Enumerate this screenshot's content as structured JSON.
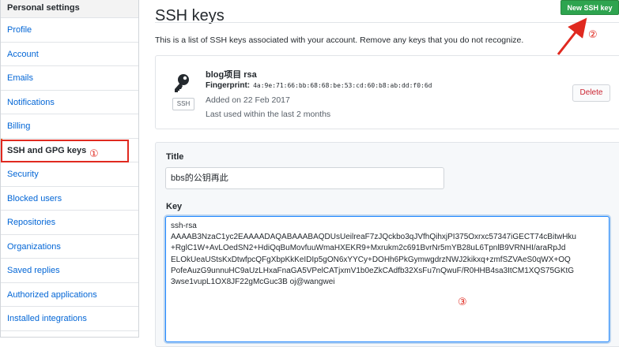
{
  "sidebar": {
    "header": "Personal settings",
    "items": [
      {
        "label": "Profile"
      },
      {
        "label": "Account"
      },
      {
        "label": "Emails"
      },
      {
        "label": "Notifications"
      },
      {
        "label": "Billing"
      },
      {
        "label": "SSH and GPG keys",
        "selected": true
      },
      {
        "label": "Security"
      },
      {
        "label": "Blocked users"
      },
      {
        "label": "Repositories"
      },
      {
        "label": "Organizations"
      },
      {
        "label": "Saved replies"
      },
      {
        "label": "Authorized applications"
      },
      {
        "label": "Installed integrations"
      }
    ]
  },
  "header": {
    "title": "SSH keys",
    "new_key_button": "New SSH key"
  },
  "intro": "This is a list of SSH keys associated with your account. Remove any keys that you do not recognize.",
  "key": {
    "name": "blog项目 rsa",
    "fingerprint_label": "Fingerprint:",
    "fingerprint": "4a:9e:71:66:bb:68:68:be:53:cd:60:b8:ab:dd:f0:6d",
    "badge": "SSH",
    "added": "Added on 22 Feb 2017",
    "last_used": "Last used within the last 2 months",
    "delete_label": "Delete"
  },
  "form": {
    "title_label": "Title",
    "title_value": "bbs的公钥再此",
    "key_label": "Key",
    "key_lines": [
      "ssh-rsa",
      "AAAAB3NzaC1yc2EAAAADAQABAAABAQDUsUeilreaF7zJQckbo3qJVfhQihxjPI375Oxrxc57347iGECT74cBitwHku",
      "+RglC1W+AvLOedSN2+HdiQqBuMovfuuWmaHXEKR9+Mxrukm2c691BvrNr5mYB28uL6TpnlB9VRNHI/araRpJd",
      "ELOkUeaUStsKxDtwfpcQFgXbpKkKeIDIp5gON6xYYCy+DOHh6PkGymwgdrzNWJ2kikxq+zmfSZVAeS0qWX+OQ",
      "PofeAuzG9unnuHC9aUzLHxaFnaGA5VPelCATjxmV1b0eZkCAdfb32XsFu7nQwuF/R0HHB4sa3ItCM1XQS75GKtG",
      "3wse1vupL1OX8JF22gMcGuc3B oj@wangwei"
    ]
  },
  "annotations": {
    "marker_1": "①",
    "marker_2": "②",
    "marker_3": "③",
    "color": "#e0291f"
  }
}
